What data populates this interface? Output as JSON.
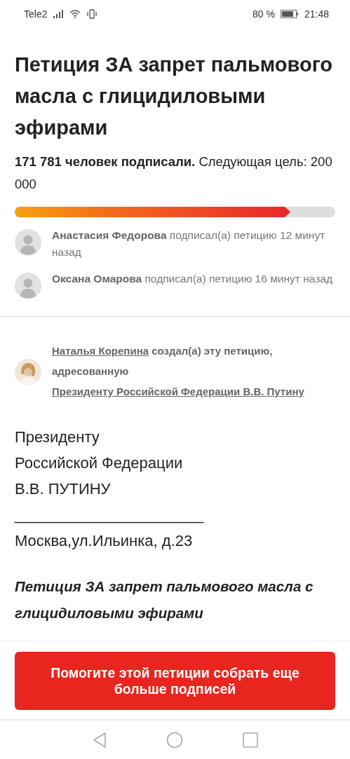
{
  "status_bar": {
    "carrier": "Tele2",
    "battery": "80 %",
    "time": "21:48"
  },
  "petition": {
    "title": "Петиция ЗА запрет пальмового масла с глицидиловыми эфирами",
    "progress_text": "**171 781 человек подписали.** Следующая цель: 200 000",
    "level": 0.86
  },
  "signers": [
    {
      "name": "Анастасия Федорова",
      "text": "подписал(а) петицию 12 минут назад"
    },
    {
      "name": "Оксана Омарова",
      "text": "подписал(а) петицию 16 минут назад"
    }
  ],
  "creator": {
    "name": "Наталья Корепина",
    "text": "создал(а) эту петицию, адресованную",
    "addressee": "Президенту Российской Федерации В.В. Путину"
  },
  "letter": {
    "lines": [
      "Президенту",
      "Российской Федерации",
      "В.В. ПУТИНУ"
    ],
    "rule": "______________________",
    "address": "Москва,ул.Ильинка, д.23",
    "heading": "Петиция ЗА запрет пальмового масла с глицидиловыми эфирами"
  },
  "cta": {
    "label": "Помогите этой петиции собрать еще больше подписей"
  }
}
